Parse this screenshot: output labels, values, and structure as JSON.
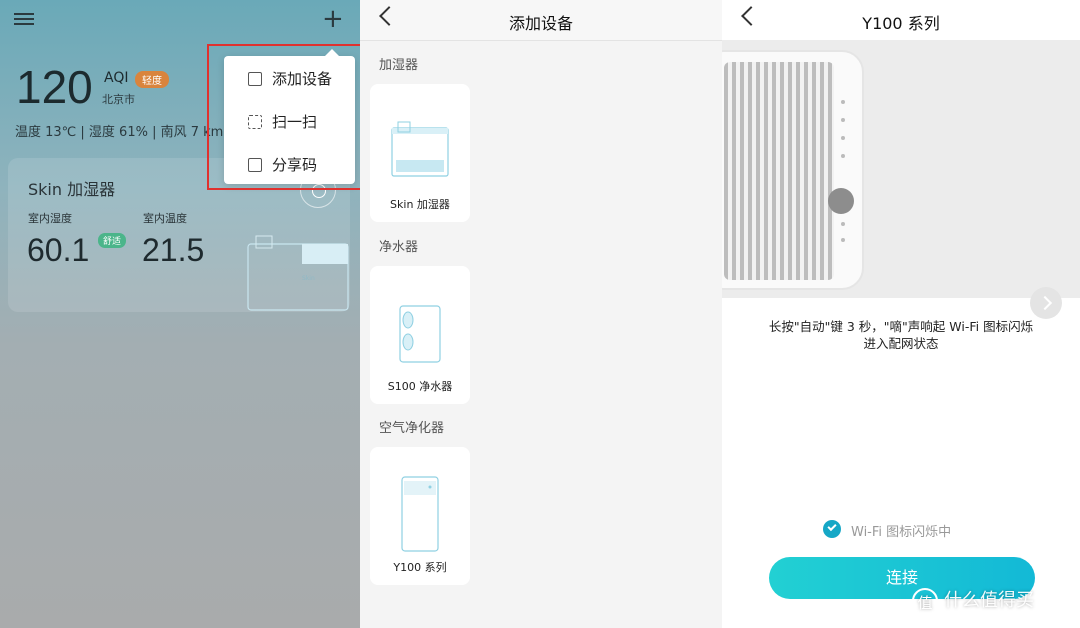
{
  "home": {
    "aqi_value": "120",
    "aqi_label": "AQI",
    "aqi_level": "轻度",
    "city": "北京市",
    "weather": "温度 13℃  |  湿度 61%  |  南风 7 km",
    "card": {
      "title": "Skin 加湿器",
      "humidity_label": "室内湿度",
      "humidity_value": "60.1",
      "comfort_badge": "舒适",
      "temperature_label": "室内温度",
      "temperature_value": "21.5",
      "device_text": "Skin"
    },
    "menu": {
      "items": [
        {
          "label": "添加设备",
          "icon": "add-device-icon"
        },
        {
          "label": "扫一扫",
          "icon": "scan-icon"
        },
        {
          "label": "分享码",
          "icon": "share-code-icon"
        }
      ]
    },
    "highlight_color": "#e0312e"
  },
  "add_device": {
    "title": "添加设备",
    "categories": [
      {
        "label": "加湿器",
        "device": "Skin 加湿器"
      },
      {
        "label": "净水器",
        "device": "S100 净水器"
      },
      {
        "label": "空气净化器",
        "device": "Y100 系列"
      }
    ]
  },
  "series": {
    "title": "Y100 系列",
    "instruction_line1": "长按\"自动\"键 3 秒，\"嘀\"声响起 Wi-Fi 图标闪烁",
    "instruction_line2": "进入配网状态",
    "checkbox_label": "Wi-Fi 图标闪烁中",
    "connect_label": "连接",
    "accent": "#13b9d6"
  },
  "watermark": {
    "badge": "值",
    "text": "什么值得买"
  }
}
